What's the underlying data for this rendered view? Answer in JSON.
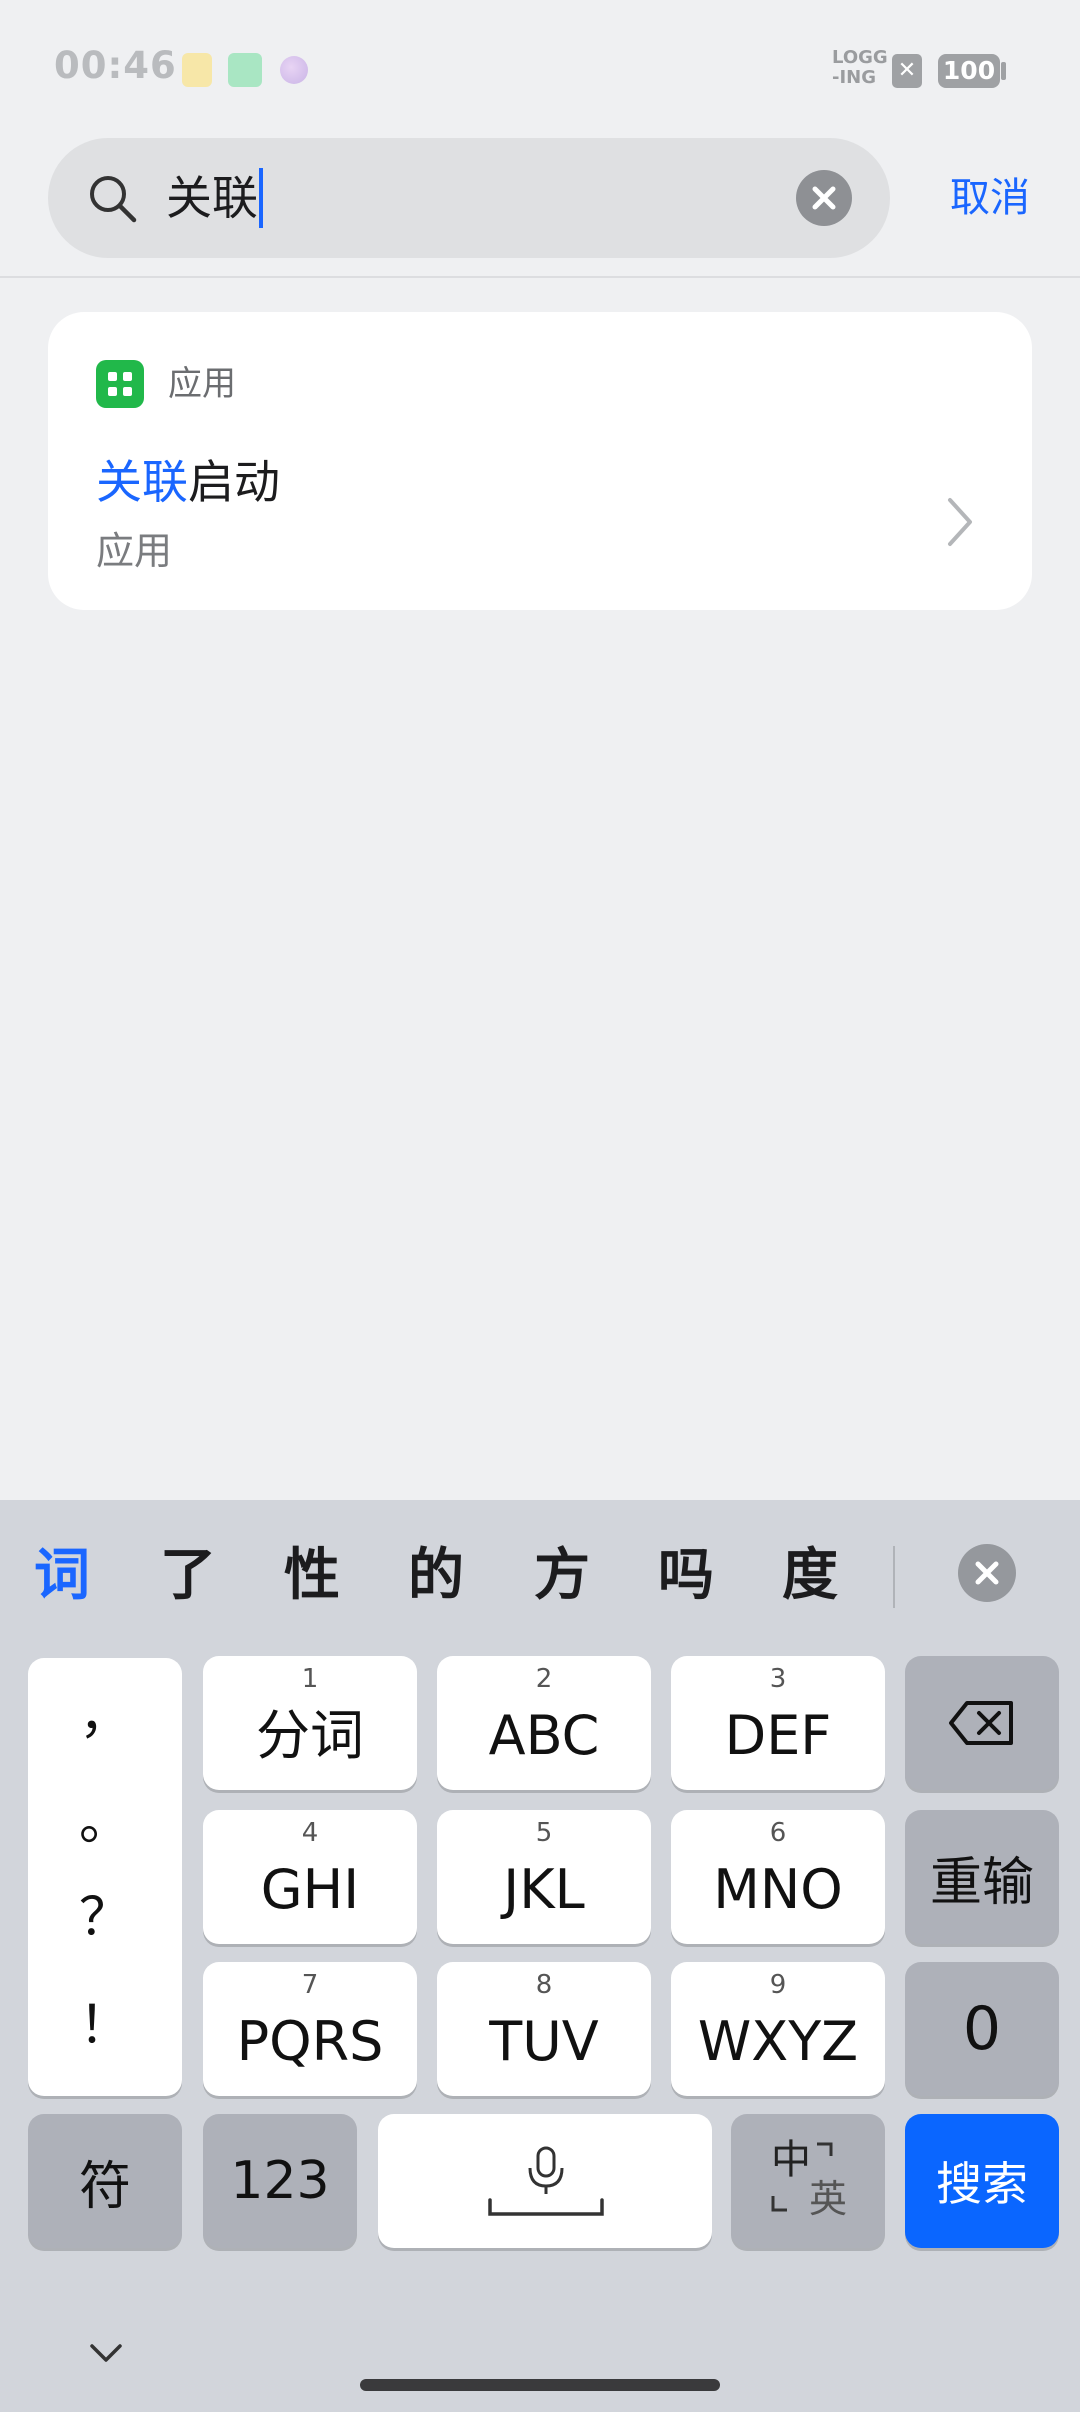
{
  "status_bar": {
    "time": "00:46",
    "logging_label": "LOGG\n-ING",
    "sim_icon": "sim-x-icon",
    "battery": "100"
  },
  "search": {
    "query": "关联",
    "cancel_label": "取消"
  },
  "results": {
    "section_title": "应用",
    "items": [
      {
        "title_highlight": "关联",
        "title_rest": "启动",
        "subtitle": "应用"
      }
    ]
  },
  "keyboard": {
    "candidates": [
      "词",
      "了",
      "性",
      "的",
      "方",
      "吗",
      "度"
    ],
    "punctuation": [
      "，",
      "。",
      "？",
      "！"
    ],
    "keys": [
      {
        "num": "1",
        "label": "分词"
      },
      {
        "num": "2",
        "label": "ABC"
      },
      {
        "num": "3",
        "label": "DEF"
      },
      {
        "num": "4",
        "label": "GHI"
      },
      {
        "num": "5",
        "label": "JKL"
      },
      {
        "num": "6",
        "label": "MNO"
      },
      {
        "num": "7",
        "label": "PQRS"
      },
      {
        "num": "8",
        "label": "TUV"
      },
      {
        "num": "9",
        "label": "WXYZ"
      }
    ],
    "reenter_label": "重输",
    "zero_label": "0",
    "symbol_label": "符",
    "numeric_label": "123",
    "lang_zh": "中",
    "lang_en": "英",
    "search_label": "搜索"
  },
  "colors": {
    "accent": "#1a66ff",
    "app_icon": "#21b84a",
    "search_key": "#0a66ff"
  }
}
